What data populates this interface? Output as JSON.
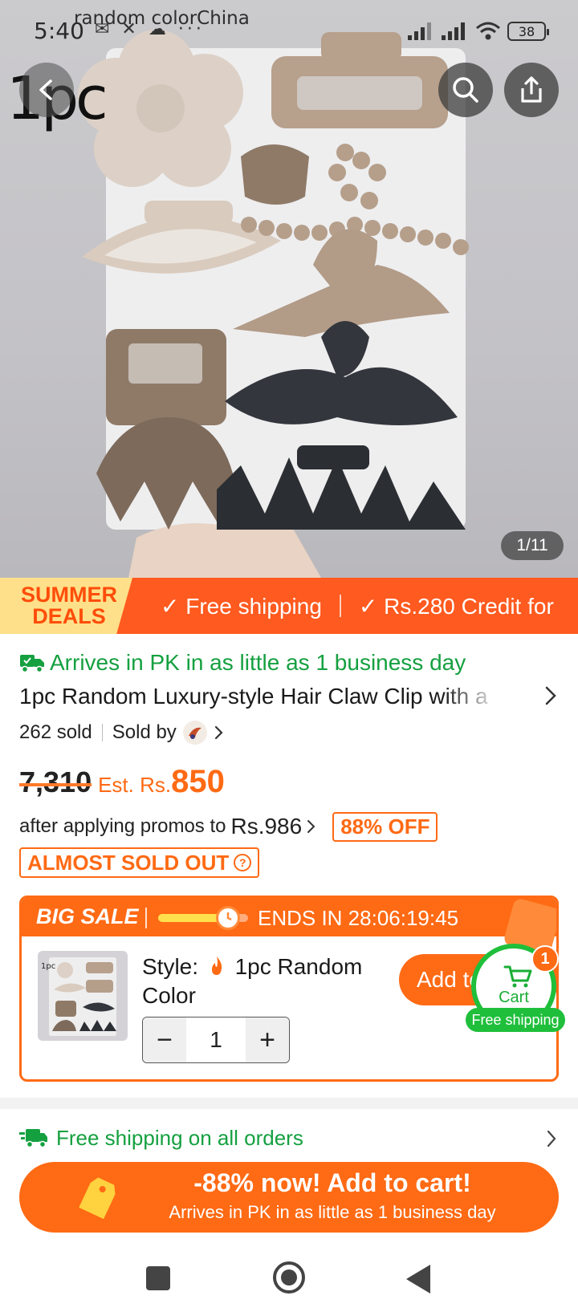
{
  "status": {
    "time": "5:40",
    "left_icons": "✉ ✕ ☁ ···",
    "battery": "38",
    "overlay_text": "random colorChina"
  },
  "hero": {
    "pc_label": "1pc",
    "counter": "1/11"
  },
  "deals_banner": {
    "logo_line1": "SUMMER",
    "logo_line2": "DEALS",
    "item1": "✓ Free shipping",
    "item2": "✓ Rs.280 Credit for"
  },
  "product": {
    "arrives": "Arrives in PK in as little as 1 business day",
    "title": "1pc Random Luxury-style Hair Claw Clip with a",
    "sold": "262 sold",
    "sold_by": "Sold by",
    "old_price": "7,310",
    "est_label": "Est. Rs.",
    "est_price": "850",
    "promo_text": "after applying promos to",
    "promo_price": "Rs.986",
    "off_badge": "88% OFF",
    "almost_sold": "ALMOST SOLD OUT"
  },
  "sale": {
    "title": "BIG SALE",
    "progress": 0.75,
    "ends": "ENDS IN 28:06:19:45",
    "style_label": "Style:",
    "style_value": "1pc Random Color",
    "quantity": "1",
    "minus": "−",
    "plus": "+",
    "add_button": "Add to"
  },
  "cart": {
    "label": "Cart",
    "count": "1",
    "free_shipping": "Free shipping"
  },
  "shipping_row": {
    "text": "Free shipping on all orders"
  },
  "cta": {
    "main": "-88% now! Add to cart!",
    "sub": "Arrives in PK in as little as 1 business day"
  },
  "colors": {
    "accent": "#ff6a14",
    "banner": "#ff5a1f",
    "green": "#15a040",
    "cart_green": "#1fbf3b"
  }
}
